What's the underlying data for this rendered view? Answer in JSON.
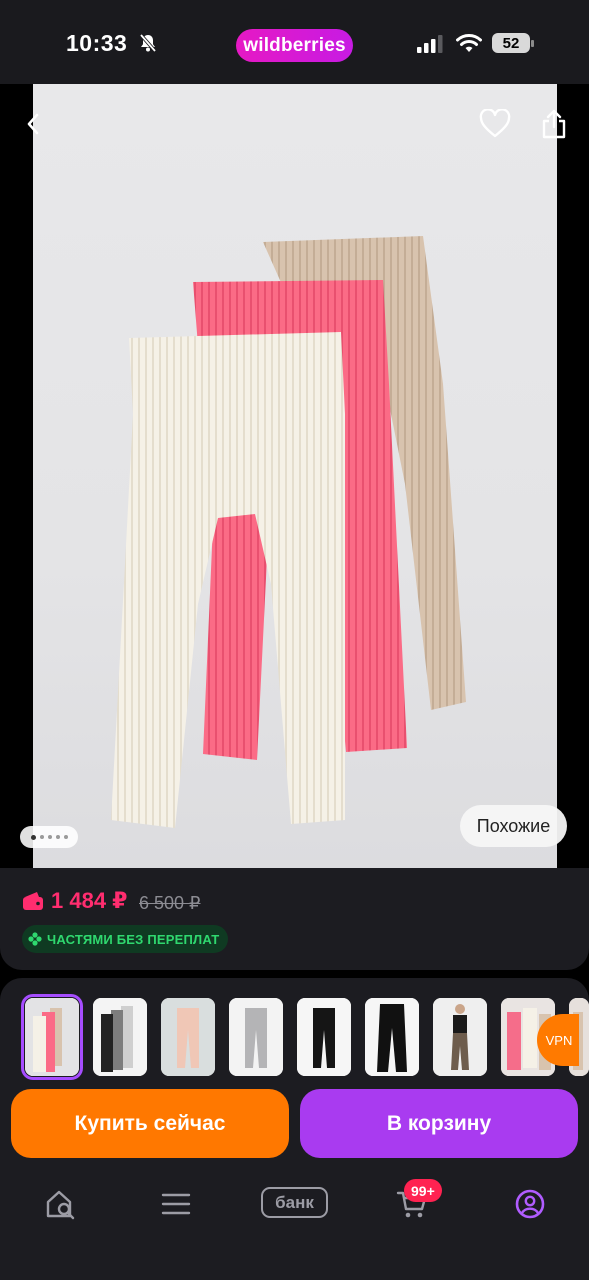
{
  "status_bar": {
    "time": "10:33",
    "app_brand": "wildberries",
    "battery": "52",
    "icons": [
      "bell-off-icon",
      "signal-icon",
      "wifi-icon",
      "battery-icon"
    ]
  },
  "product_photo": {
    "current_slide": 1,
    "total_slides": 5,
    "similar_button": "Похожие",
    "icons": [
      "back-icon",
      "heart-icon",
      "share-icon"
    ]
  },
  "price": {
    "current": "1 484 ₽",
    "old": "6 500 ₽",
    "installment": "ЧАСТЯМИ БЕЗ ПЕРЕПЛАТ"
  },
  "thumbnails": {
    "count": 9,
    "selected_index": 0
  },
  "vpn_badge": "VPN",
  "actions": {
    "buy_now": "Купить сейчас",
    "add_to_cart": "В корзину"
  },
  "bottom_nav": {
    "items": [
      "home-search-icon",
      "menu-icon",
      "bank",
      "cart-icon",
      "profile-icon"
    ],
    "bank_label": "банк",
    "cart_badge": "99+"
  },
  "colors": {
    "brand": "#cb11e8",
    "price": "#ff2d6f",
    "buy": "#ff7800",
    "cart": "#a93bf0",
    "installment": "#2fd86f",
    "active_nav": "#b05cff"
  }
}
